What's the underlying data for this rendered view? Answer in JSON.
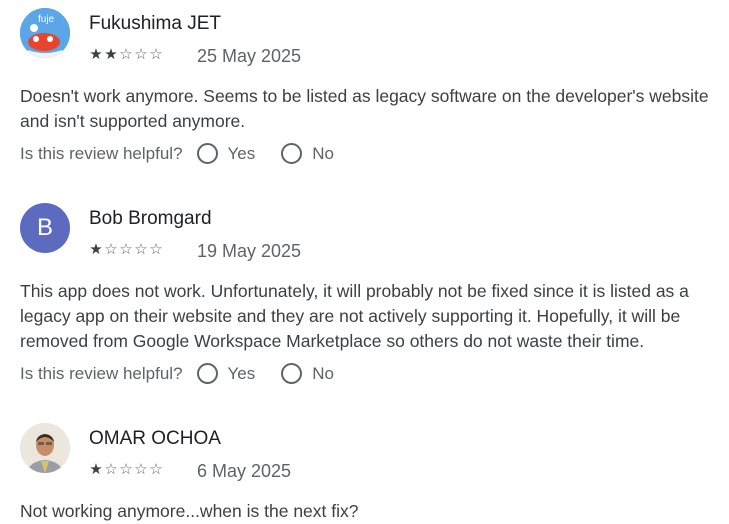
{
  "reviews": [
    {
      "author": "Fukushima JET",
      "avatar_type": "image",
      "avatar_text": "fuje",
      "rating": 2,
      "max_rating": 5,
      "date": "25 May 2025",
      "text": "Doesn't work anymore. Seems to be listed as legacy software on the developer's website and isn't supported anymore.",
      "helpful_prompt": "Is this review helpful?",
      "yes_label": "Yes",
      "no_label": "No"
    },
    {
      "author": "Bob Bromgard",
      "avatar_type": "letter",
      "avatar_letter": "B",
      "avatar_color": "#5c6bc0",
      "rating": 1,
      "max_rating": 5,
      "date": "19 May 2025",
      "text": "This app does not work. Unfortunately, it will probably not be fixed since it is listed as a legacy app on their website and they are not actively supporting it. Hopefully, it will be removed from Google Workspace Marketplace so others do not waste their time.",
      "helpful_prompt": "Is this review helpful?",
      "yes_label": "Yes",
      "no_label": "No"
    },
    {
      "author": "OMAR OCHOA",
      "avatar_type": "photo",
      "rating": 1,
      "max_rating": 5,
      "date": "6 May 2025",
      "text": "Not working anymore...when is the next fix?"
    }
  ],
  "colors": {
    "filled_star": "#3c4043",
    "empty_star": "#5f6368"
  }
}
